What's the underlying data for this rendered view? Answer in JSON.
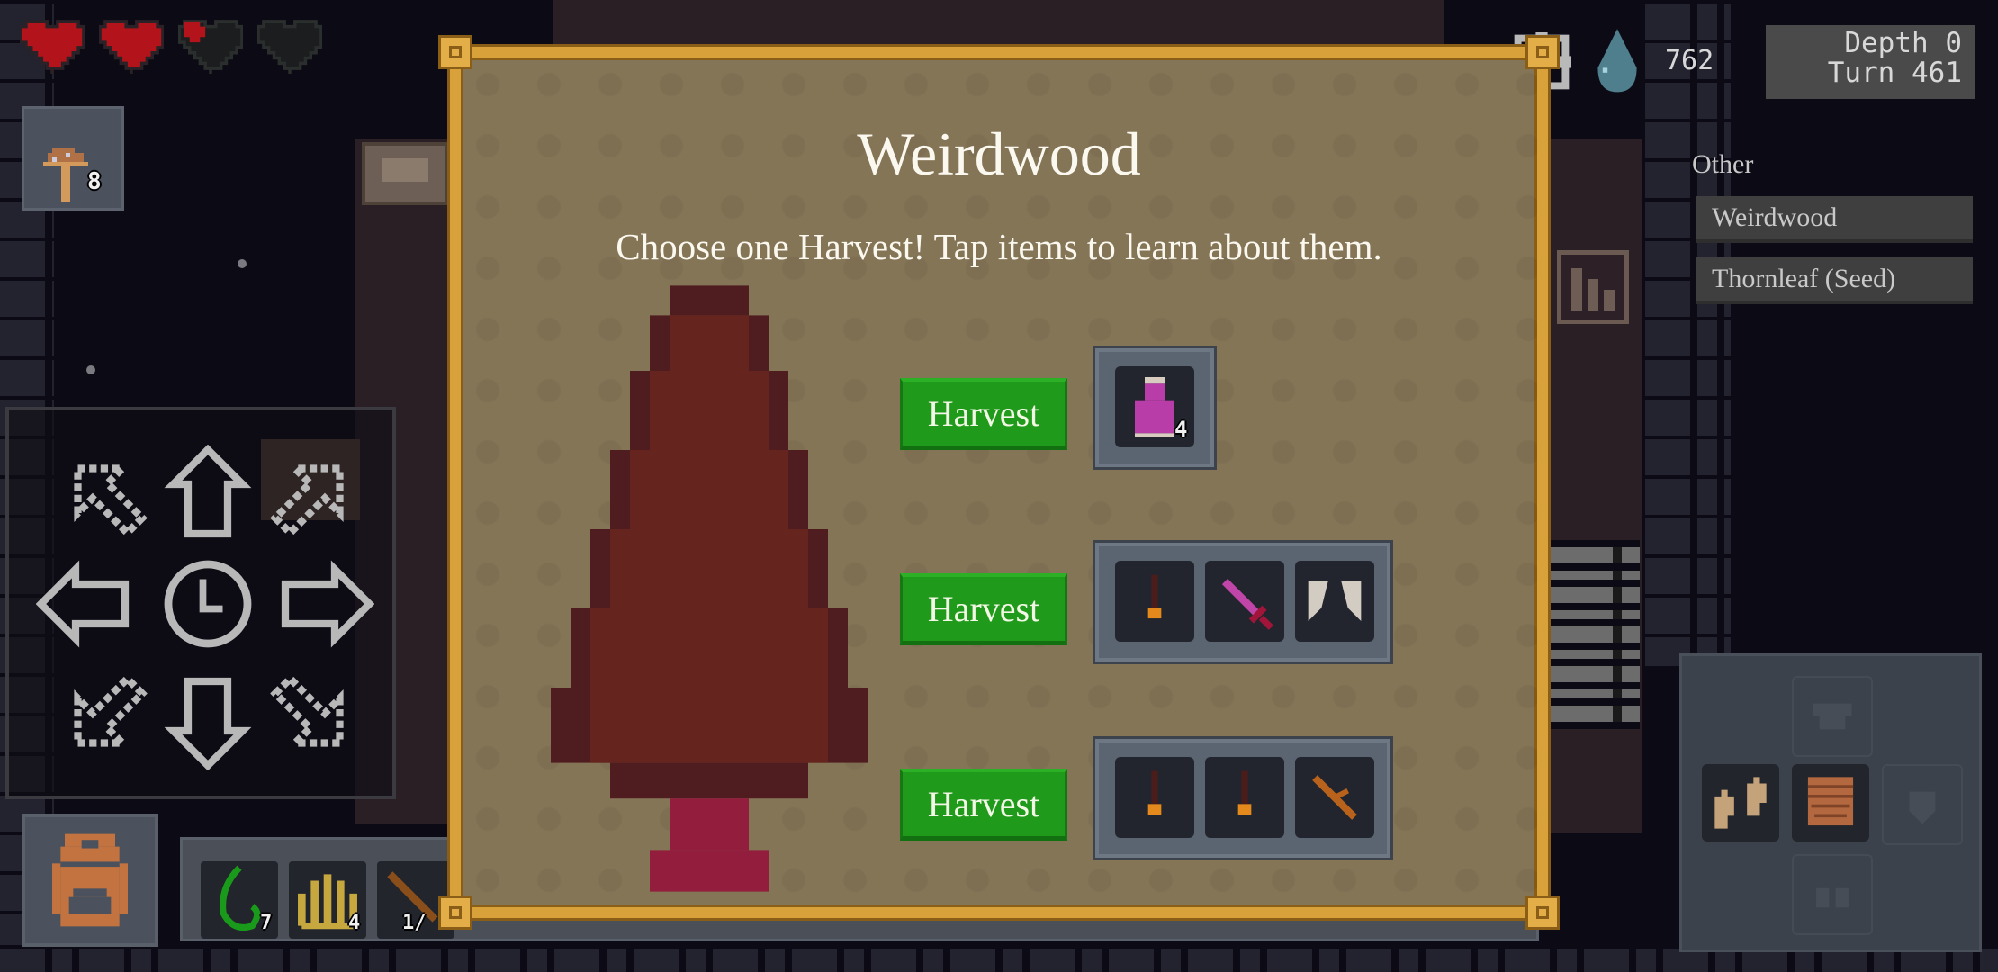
{
  "hud": {
    "hearts": [
      {
        "name": "heart-full",
        "state": "full"
      },
      {
        "name": "heart-full",
        "state": "full"
      },
      {
        "name": "heart-partial",
        "state": "partial"
      },
      {
        "name": "heart-empty",
        "state": "empty"
      }
    ],
    "quick_item": {
      "icon": "mushroom-icon",
      "count": "8"
    },
    "mana": "762",
    "depth_label": "Depth 0",
    "turn_label": "Turn 461"
  },
  "sidebar": {
    "section_label": "Other",
    "items": [
      {
        "label": "Weirdwood"
      },
      {
        "label": "Thornleaf (Seed)"
      }
    ]
  },
  "dialog": {
    "title": "Weirdwood",
    "subtitle": "Choose one Harvest! Tap items to learn about them.",
    "options": [
      {
        "button": "Harvest",
        "items": [
          {
            "icon": "pink-potion-icon",
            "count": "4"
          }
        ]
      },
      {
        "button": "Harvest",
        "items": [
          {
            "icon": "torch-icon"
          },
          {
            "icon": "pink-sword-icon"
          },
          {
            "icon": "wings-icon"
          }
        ]
      },
      {
        "button": "Harvest",
        "items": [
          {
            "icon": "torch-icon"
          },
          {
            "icon": "torch-icon"
          },
          {
            "icon": "wooden-stick-icon"
          }
        ]
      }
    ]
  },
  "quickbar": {
    "items": [
      {
        "icon": "green-vine-icon",
        "count": "7"
      },
      {
        "icon": "yellow-grass-icon",
        "count": "4"
      },
      {
        "icon": "stick-icon",
        "count": "1/"
      }
    ]
  },
  "colors": {
    "harvest_green": "#1f9a1a",
    "parchment": "#857557",
    "frame_gold": "#d9a13a",
    "heart_red": "#b3141b"
  }
}
